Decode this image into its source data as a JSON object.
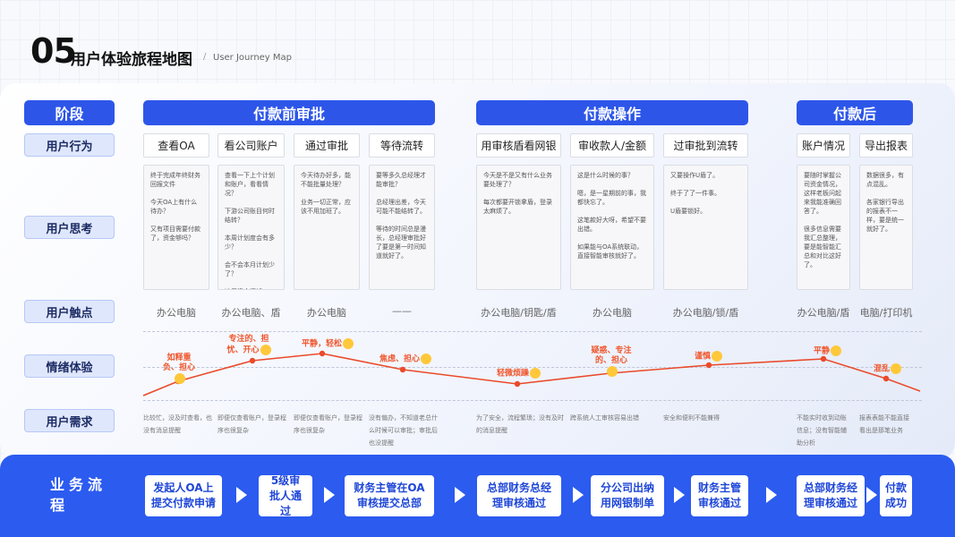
{
  "header": {
    "number": "05",
    "title": "用户体验旅程地图",
    "separator": "/",
    "subtitle": "User Journey Map"
  },
  "row_labels": [
    "阶段",
    "用户行为",
    "用户思考",
    "用户触点",
    "情绪体验",
    "用户需求"
  ],
  "stages": [
    "付款前审批",
    "付款操作",
    "付款后"
  ],
  "behaviors": [
    "查看OA",
    "看公司账户",
    "通过审批",
    "等待流转",
    "用审核盾看网银",
    "审收款人/金额",
    "过审批到流转",
    "账户情况",
    "导出报表"
  ],
  "thoughts": [
    "终于完成年终财务回报文件\n\n今天OA上有什么待办？\n\n又有项目需要付款了，资金够吗？",
    "查看一下上个计划和账户，看看情况？\n\n下游公司账目何时结转？\n\n本周计划度会有多少？\n\n会不会本月计划少了？\n\n这周资金还够。",
    "今天待办好多，能不能批量处理？\n\n业务一切正常，应该不用加班了。",
    "要等多久总经理才能审批？\n\n总经理出差，今天可能不能结转了。\n\n等待的时间总是漫长，总经理审批好了要是第一时间知道就好了。",
    "今天是不是又有什么业务要处理了？\n\n每次都要开锁拿盾，登录太麻烦了。",
    "这是什么时候的事？\n\n嗯，是一星期前的事，我都快忘了。\n\n这笔款好大呀，希望不要出错。\n\n如果能与OA系统联动，直接智能审核就好了。",
    "又要操作U盾了。\n\n终于了了一件事。\n\nU盾要锁好。",
    "要随时掌握公司资金情况，这样老板问起来我能准确回答了。\n\n很多信息需要我汇总整理，要是能智能汇总和对比这好了。",
    "数据很多，有点混乱。\n\n各家银行导出的报表不一样，要是统一就好了。"
  ],
  "touchpoints": [
    "办公电脑",
    "办公电脑、盾",
    "办公电脑",
    "——",
    "办公电脑/钥匙/盾",
    "办公电脑",
    "办公电脑/锁/盾",
    "办公电脑/盾",
    "电脑/打印机"
  ],
  "emotions": [
    "如释重负、担心",
    "专注的、担忧、开心",
    "平静，轻松",
    "焦虑、担心",
    "轻微烦躁",
    "疑惑、专注的、担心",
    "谨慎",
    "平静",
    "混乱"
  ],
  "emotion_curve": [
    0,
    1,
    2,
    3,
    4,
    5,
    6,
    7,
    8,
    9,
    10
  ],
  "needs": [
    "比较忙，没及时查看，也没有消息提醒",
    "即便仅查看账户，登录程序也很复杂",
    "即便仅查看账户，登录程序也很复杂",
    "没有偏办，不知道老总什么时候可以审批；审批后也没提醒",
    "为了安全，流程繁琐；没有及时的消息提醒",
    "跨系统人工审核容易出错",
    "安全和便利不能兼得",
    "不能实时收到动账信息；没有智能辅助分析",
    "报表表能不能直接看出是那笔业务"
  ],
  "flow": {
    "label": "业务流程",
    "steps": [
      "发起人OA上提交付款申请",
      "5级审批人通过",
      "财务主管在OA审核提交总部",
      "总部财务总经理审核通过",
      "分公司出纳用网银制单",
      "财务主管审核通过",
      "总部财务经理审核通过",
      "付款成功"
    ]
  },
  "colors": {
    "primary": "#2d56e9",
    "curve": "#ea4a2a",
    "emotion_text": "#f0572e"
  }
}
